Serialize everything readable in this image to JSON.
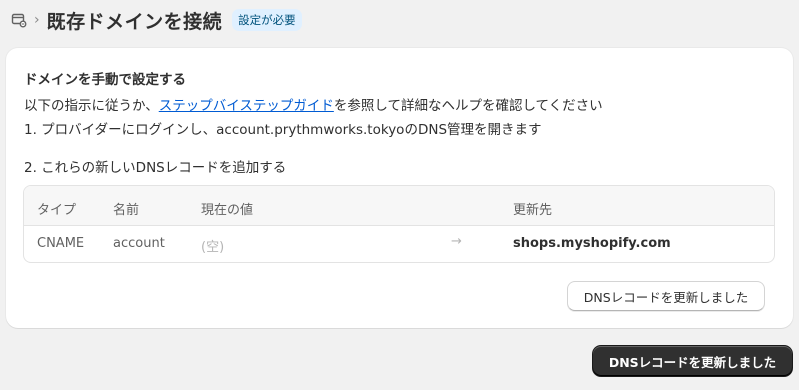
{
  "header": {
    "icon": "domain-icon",
    "separator": "›",
    "title": "既存ドメインを接続",
    "badge": "設定が必要"
  },
  "card": {
    "heading": "ドメインを手動で設定する",
    "instructions_prefix": "以下の指示に従うか、",
    "instructions_link": "ステップバイステップガイド",
    "instructions_suffix": "を参照して詳細なヘルプを確認してください",
    "step1": "1. プロバイダーにログインし、account.prythmworks.tokyoのDNS管理を開きます",
    "step2": "2. これらの新しいDNSレコードを追加する",
    "table": {
      "headers": [
        "タイプ",
        "名前",
        "現在の値",
        "更新先"
      ],
      "rows": [
        {
          "type": "CNAME",
          "name": "account",
          "current": "(空)",
          "arrow": "→",
          "target": "shops.myshopify.com"
        }
      ]
    },
    "verify_button": "DNSレコードを更新しました"
  },
  "footer": {
    "primary_button": "DNSレコードを更新しました"
  },
  "colors": {
    "background": "#f1f1f1",
    "card": "#ffffff",
    "link": "#005bd3",
    "badge_bg": "#e0f0ff",
    "badge_text": "#00527c",
    "primary_button_bg": "#303030"
  }
}
